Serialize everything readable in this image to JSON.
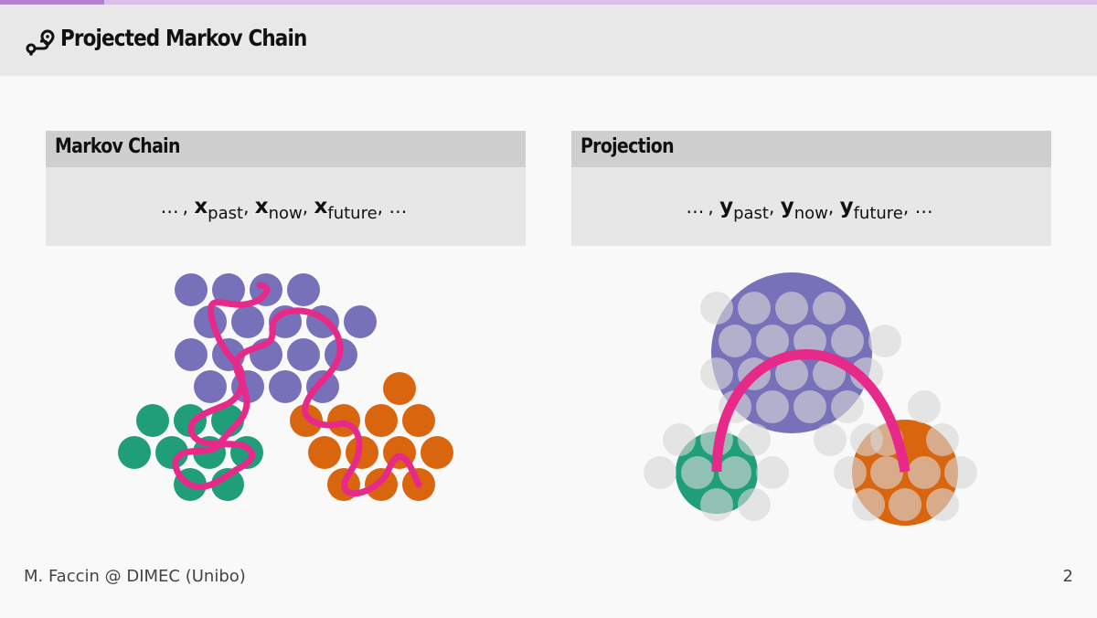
{
  "slide": {
    "title": "Projected Markov Chain",
    "title_icon": "route-pin-icon",
    "progress_fraction": 0.095,
    "page_number": "2",
    "footer_text": "M. Faccin @ DIMEC (Unibo)"
  },
  "blocks": {
    "left": {
      "title": "Markov Chain",
      "dots": "…",
      "var": "x",
      "subs": [
        "past",
        "now",
        "future"
      ]
    },
    "right": {
      "title": "Projection",
      "dots": "…",
      "var": "y",
      "subs": [
        "past",
        "now",
        "future"
      ]
    }
  },
  "colors": {
    "purple": "#7671b8",
    "green": "#1f9e79",
    "orange": "#d9650f",
    "magenta": "#e7298a",
    "grey": "#d0d0d0",
    "progress": "#b67fcf"
  }
}
